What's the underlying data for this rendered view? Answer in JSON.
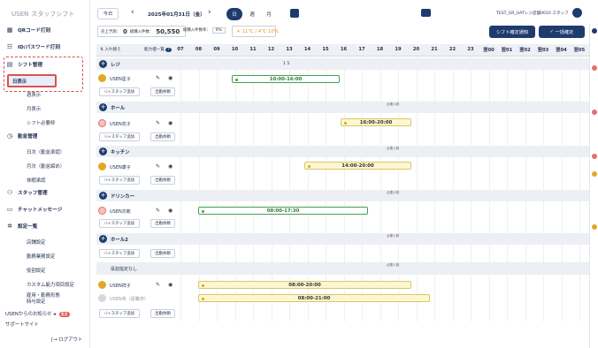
{
  "app": {
    "brand": "USEN",
    "product": "スタッフシフト"
  },
  "sidebar": {
    "items": [
      {
        "id": "qr",
        "label": "QRコード打刻",
        "icon": "qr-icon"
      },
      {
        "id": "id",
        "label": "ID/パスワード打刻",
        "icon": "id-card-icon"
      },
      {
        "id": "shift",
        "label": "シフト管理",
        "icon": "calendar-icon"
      },
      {
        "id": "attendance",
        "label": "勤怠管理",
        "icon": "clock-icon"
      },
      {
        "id": "staff",
        "label": "スタッフ管理",
        "icon": "staff-icon"
      },
      {
        "id": "chat",
        "label": "チャットメッセージ",
        "icon": "chat-icon"
      },
      {
        "id": "settings",
        "label": "設定一覧",
        "icon": "gear-icon"
      }
    ],
    "shift_sub": [
      "日表示",
      "週表示",
      "月表示",
      "シフト必要枠"
    ],
    "attendance_sub": [
      "日次（勤怠承認）",
      "月次（勤怠締め）",
      "休暇承認"
    ],
    "settings_sub": [
      "店舗設定",
      "勤務業務設定",
      "役割設定",
      "カスタム能力項目設定",
      "雇用・勤務形態\n時与設定"
    ],
    "notice": "USENからのお知らせ",
    "notice_badge": "重要",
    "support": "サポートサイト",
    "logout": "ログアウト"
  },
  "topbar": {
    "today": "今日",
    "date": "2025年01月31日（金）",
    "views": [
      "日",
      "週",
      "月"
    ],
    "weather": "11℃ / 4℃ 10%",
    "store": "TEST_GR_UATレジ店舗0010 スタッフ",
    "stats": [
      {
        "label": "売上予測：",
        "value": "0"
      },
      {
        "label": "総購入件数：",
        "value": "50,550"
      },
      {
        "label": "総購入件数率：",
        "value": "0%"
      }
    ],
    "notify_btn": "シフト確定通知",
    "confirm_btn": "一括確定"
  },
  "grid": {
    "header_left": "入れ替え",
    "header_ability": "能力値一覧",
    "hours": [
      "07",
      "08",
      "09",
      "10",
      "11",
      "12",
      "13",
      "14",
      "15",
      "16",
      "17",
      "18",
      "19",
      "20",
      "21",
      "22",
      "23",
      "翌00",
      "翌01",
      "翌02",
      "翌03",
      "翌04",
      "翌05"
    ],
    "need_label": "必要人数",
    "counter": "1  5",
    "add_staff": "スタッフ追加",
    "apply_btn": "出勤依頼"
  },
  "sections": [
    {
      "name": "レジ",
      "employee": "USEN星子",
      "shift": "10:00-16:00",
      "color": "green"
    },
    {
      "name": "ホール",
      "employee": "USEN花子",
      "shift": "16:00-20:00",
      "color": "yellow"
    },
    {
      "name": "キッチン",
      "employee": "USEN康子",
      "shift": "14:00-20:00",
      "color": "yellow"
    },
    {
      "name": "ドリンカー",
      "employee": "USEN次郎",
      "shift": "08:00-17:30",
      "color": "green"
    },
    {
      "name": "ホール2",
      "employee": "",
      "shift": "",
      "color": ""
    }
  ],
  "no_role": {
    "label": "役割指定なし",
    "rows": [
      {
        "employee": "USEN祥子",
        "shift": "08:00-20:00"
      },
      {
        "employee": "USEN朱（退職済）",
        "shift": "08:00-21:00"
      }
    ]
  }
}
